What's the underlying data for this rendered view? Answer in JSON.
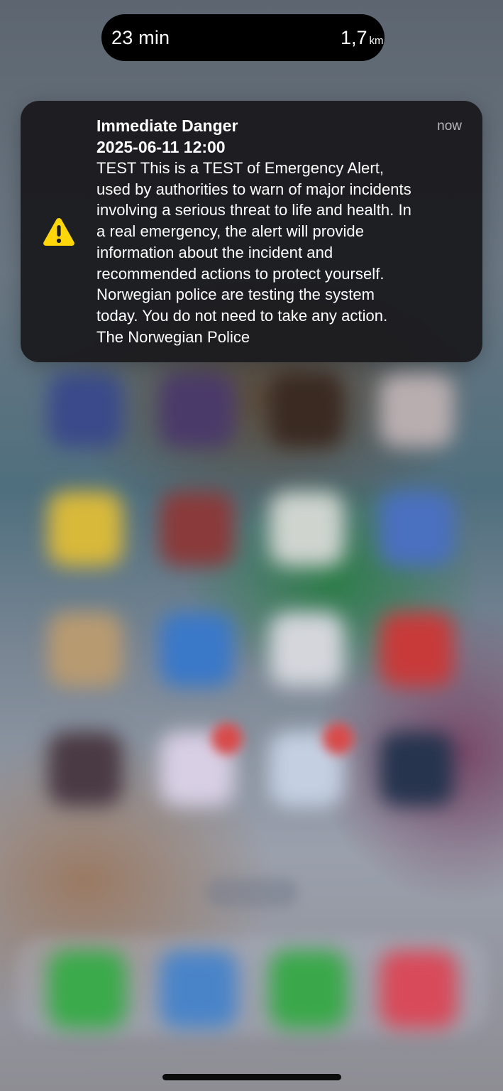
{
  "live_activity": {
    "duration": "23 min",
    "distance_value": "1,7",
    "distance_unit": "km"
  },
  "notification": {
    "title": "Immediate Danger",
    "datetime": "2025-06-11 12:00",
    "timestamp": "now",
    "icon": "warning-triangle-icon",
    "icon_color": "#FFD60A",
    "body": "TEST This is a TEST of Emergency Alert,\nused by authorities to warn of major incidents\ninvolving a serious threat to life and health. In\na real emergency, the alert will provide\ninformation about the incident and\nrecommended actions to protect yourself.\nNorwegian police are testing the system\ntoday. You do not need to take any action.\nThe Norwegian Police"
  },
  "colors": {
    "card_background": "#1C1C1F",
    "island_background": "#000000",
    "text_primary": "#FFFFFF",
    "text_secondary": "#B8B8BD"
  }
}
